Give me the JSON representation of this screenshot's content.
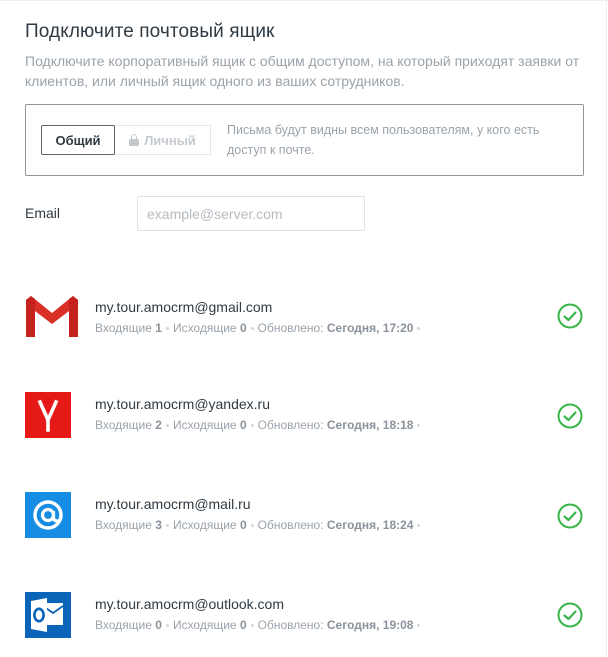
{
  "header": {
    "title": "Подключите почтовый ящик",
    "subtitle": "Подключите корпоративный ящик с общим доступом, на который приходят заявки от клиентов, или личный ящик одного из ваших сотрудников."
  },
  "access": {
    "shared_label": "Общий",
    "personal_label": "Личный",
    "selected": "shared",
    "hint": "Письма будут видны всем пользователям, у кого есть доступ к почте."
  },
  "email_field": {
    "label": "Email",
    "value": "",
    "placeholder": "example@server.com"
  },
  "labels": {
    "incoming": "Входящие",
    "outgoing": "Исходящие",
    "updated": "Обновлено:"
  },
  "mailboxes": [
    {
      "provider": "gmail",
      "icon": "gmail-icon",
      "address": "my.tour.amocrm@gmail.com",
      "incoming": "1",
      "outgoing": "0",
      "updated": "Сегодня, 17:20",
      "status": "connected"
    },
    {
      "provider": "yandex",
      "icon": "yandex-icon",
      "address": "my.tour.amocrm@yandex.ru",
      "incoming": "2",
      "outgoing": "0",
      "updated": "Сегодня, 18:18",
      "status": "connected"
    },
    {
      "provider": "mailru",
      "icon": "mailru-icon",
      "address": "my.tour.amocrm@mail.ru",
      "incoming": "3",
      "outgoing": "0",
      "updated": "Сегодня, 18:24",
      "status": "connected"
    },
    {
      "provider": "outlook",
      "icon": "outlook-icon",
      "address": "my.tour.amocrm@outlook.com",
      "incoming": "0",
      "outgoing": "0",
      "updated": "Сегодня, 19:08",
      "status": "connected"
    }
  ],
  "colors": {
    "gmail_red": "#d93025",
    "yandex_red": "#e51a17",
    "mailru_blue": "#168de2",
    "outlook_blue": "#0a64b8",
    "status_green": "#39b54a"
  }
}
